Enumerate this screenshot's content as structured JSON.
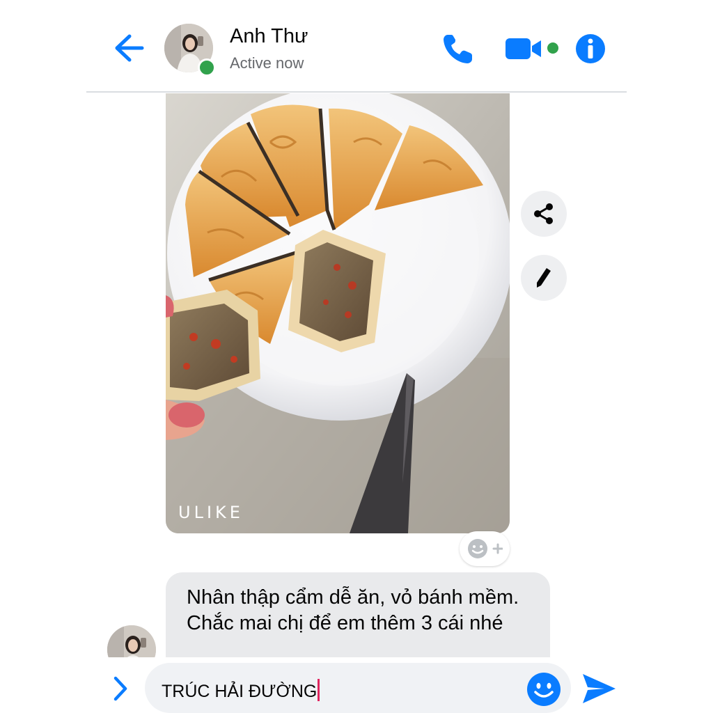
{
  "header": {
    "contact_name": "Anh Thư",
    "status": "Active now",
    "icons": {
      "back": "back-arrow-icon",
      "call": "phone-icon",
      "video": "video-camera-icon",
      "info": "info-icon"
    }
  },
  "message": {
    "photo": {
      "watermark": "ULIKE",
      "subject": "sliced mooncakes on a white plate with a knife"
    },
    "side_actions": [
      "share-icon",
      "pencil-icon"
    ],
    "reaction_icon": "add-reaction-icon",
    "text": "Nhân thập cẩm dễ ăn, vỏ bánh mềm. Chắc mai chị để em thêm 3 cái nhé"
  },
  "composer": {
    "value": "TRÚC HẢI ĐƯỜNG",
    "icons": {
      "expand": "chevron-right-icon",
      "emoji": "smiley-icon",
      "send": "send-icon"
    }
  },
  "colors": {
    "accent": "#0a7cff",
    "online": "#31a24c",
    "bubble": "#e9eaec",
    "input": "#f0f2f5"
  }
}
